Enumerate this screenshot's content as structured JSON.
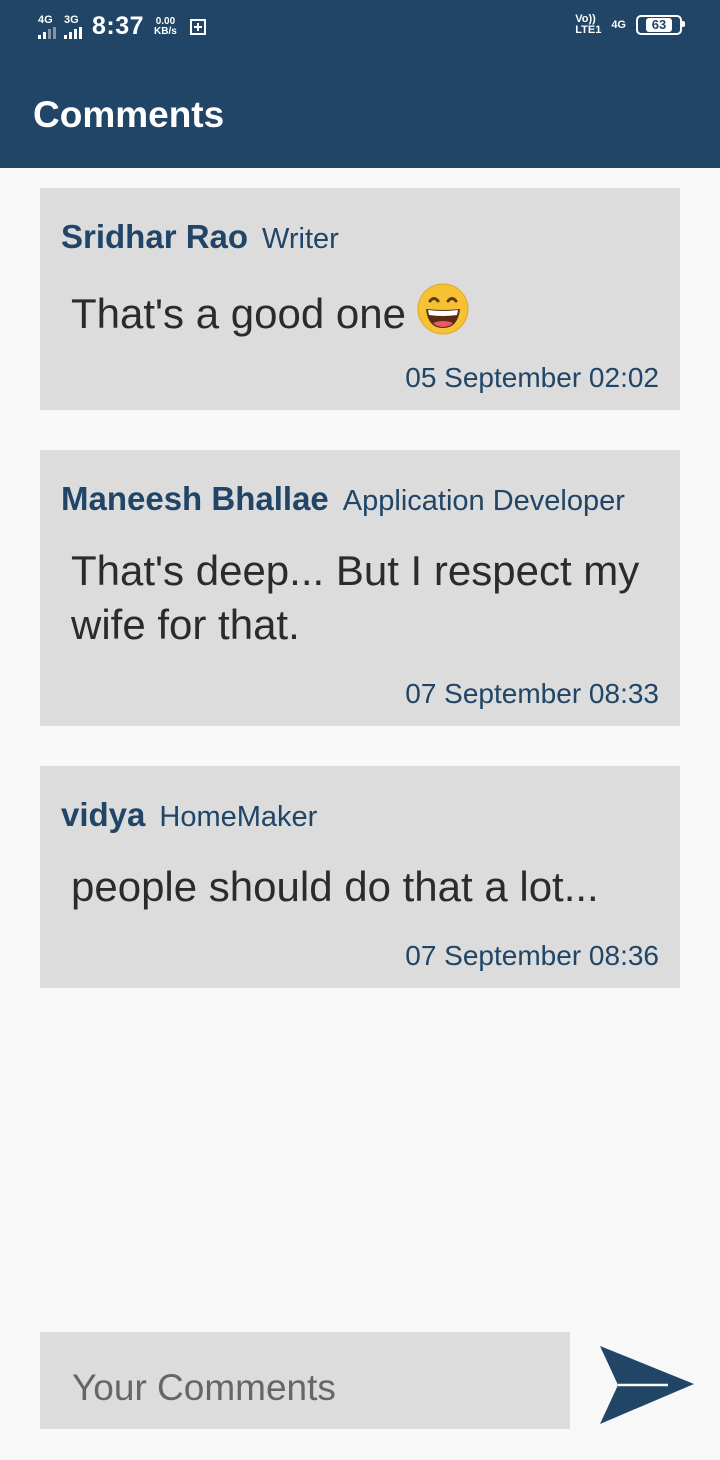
{
  "status_bar": {
    "net1": "4G",
    "net2": "3G",
    "time": "8:37",
    "speed_value": "0.00",
    "speed_unit": "KB/s",
    "volte_top": "Vo))",
    "volte_bottom": "LTE1",
    "net3": "4G",
    "battery": "63"
  },
  "app_bar": {
    "title": "Comments"
  },
  "comments": [
    {
      "name": "Sridhar Rao",
      "role": "Writer",
      "text": "That's a good one",
      "emoji": "grinning-face-emoji",
      "date": "05 September 02:02"
    },
    {
      "name": "Maneesh Bhallae",
      "role": "Application Developer",
      "text": "That's deep... But I respect my wife for that.",
      "date": "07 September 08:33"
    },
    {
      "name": "vidya",
      "role": "HomeMaker",
      "text": "people should do that a lot...",
      "date": "07 September 08:36"
    }
  ],
  "comment_input": {
    "placeholder": "Your Comments"
  },
  "icons": {
    "send": "send-icon"
  },
  "colors": {
    "primary": "#204566",
    "card": "#dcdcdc",
    "background": "#f8f8f8",
    "text": "#2b2b2b"
  }
}
